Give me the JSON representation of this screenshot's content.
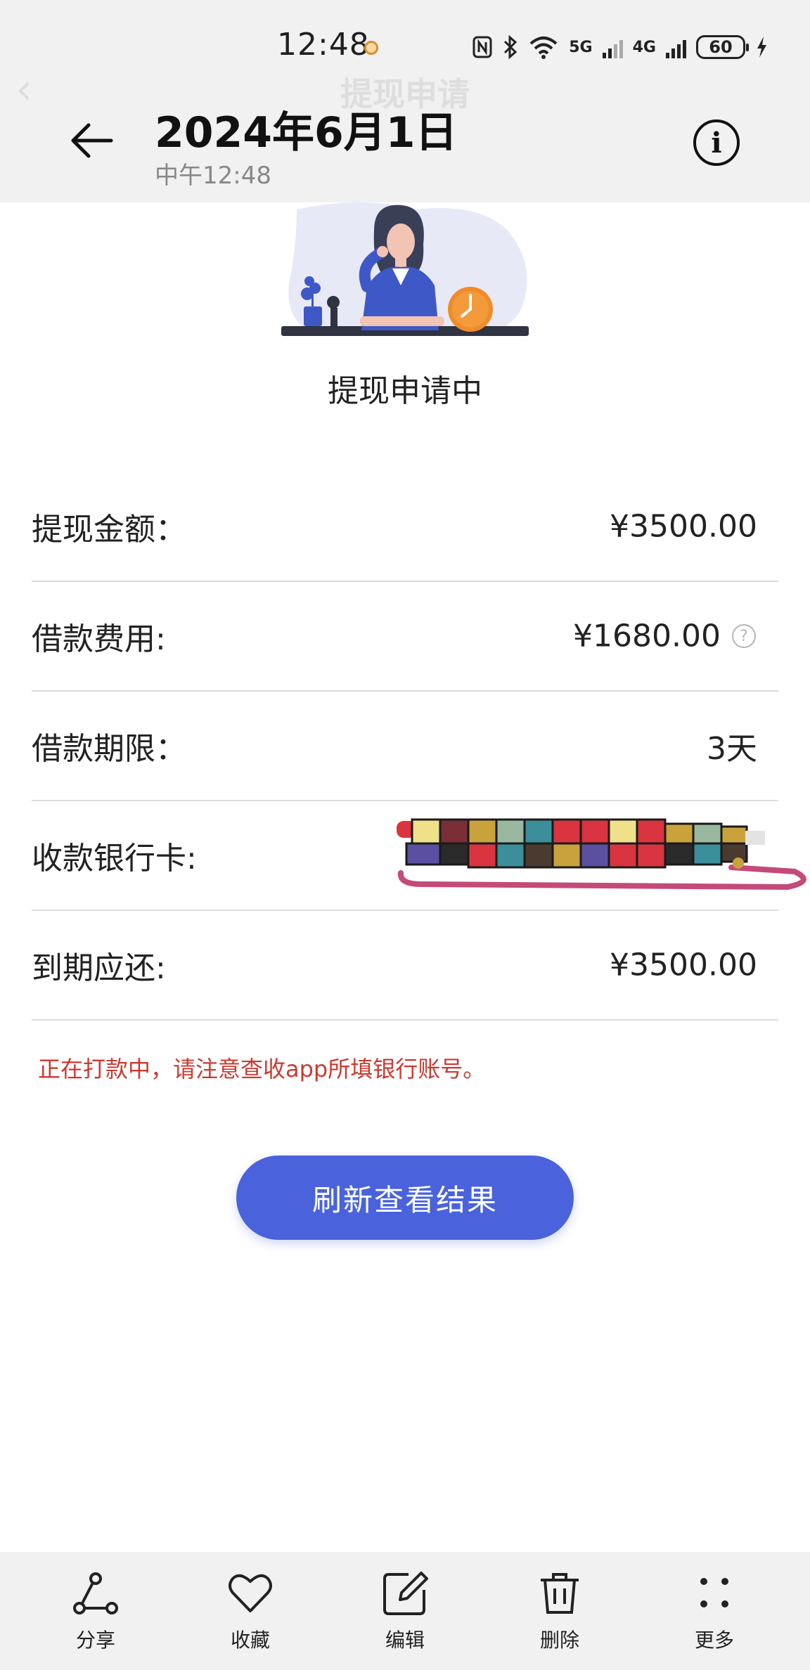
{
  "status_bar": {
    "time": "12:48",
    "net_5g": "5G",
    "net_4g": "4G",
    "battery": "60"
  },
  "header": {
    "ghost_title": "提现申请",
    "date_title": "2024年6月1日",
    "time_sub": "中午12:48"
  },
  "main": {
    "status_heading": "提现申请中",
    "rows": [
      {
        "label": "提现金额：",
        "value": "¥3500.00"
      },
      {
        "label": "借款费用:",
        "value": "¥1680.00"
      },
      {
        "label": "借款期限：",
        "value": "3天"
      },
      {
        "label": "收款银行卡:",
        "value": ""
      },
      {
        "label": "到期应还:",
        "value": "¥3500.00"
      }
    ],
    "notice": "正在打款中，请注意查收app所填银行账号。",
    "refresh_button": "刷新查看结果",
    "notice_color": "#c93a30",
    "accent": "#4a63dc"
  },
  "toolbar": {
    "share": "分享",
    "favorite": "收藏",
    "edit": "编辑",
    "delete": "删除",
    "more": "更多"
  }
}
